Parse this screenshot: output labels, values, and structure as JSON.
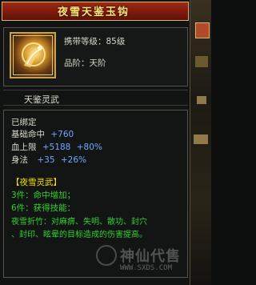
{
  "item": {
    "title": "夜雪天鉴玉钩",
    "level_label": "携带等级：85级",
    "rank_label": "品阶：天阶",
    "subname": "天鉴灵武"
  },
  "stats": {
    "bound": "已绑定",
    "base_hit_label": "基础命中",
    "base_hit_value": "+760",
    "hp_label": "血上限",
    "hp_value": "+5188",
    "hp_pct": "+80%",
    "agility_label": "身法",
    "agility_value": "+35",
    "agility_pct": "+26%"
  },
  "set": {
    "name": "【夜雪灵武】",
    "line1": "3件：命中增加；",
    "line2": "6件：获得技能：",
    "line3": "夜雪折竹：对麻痹、失明、散功、封穴",
    "line4": "、封印、眩晕的目标造成的伤害提高。"
  },
  "watermark": {
    "text": "神仙代售",
    "url": "WWW.SXDS.COM"
  },
  "colors": {
    "title_bg": "#7e1a0c",
    "title_text": "#ffe27a",
    "green": "#2ed12e",
    "blue": "#6ea8ff",
    "yellow": "#f5e000"
  },
  "icons": {
    "item_icon": "jade-hook-weapon-icon",
    "watermark_icon": "sxds-logo-icon"
  }
}
